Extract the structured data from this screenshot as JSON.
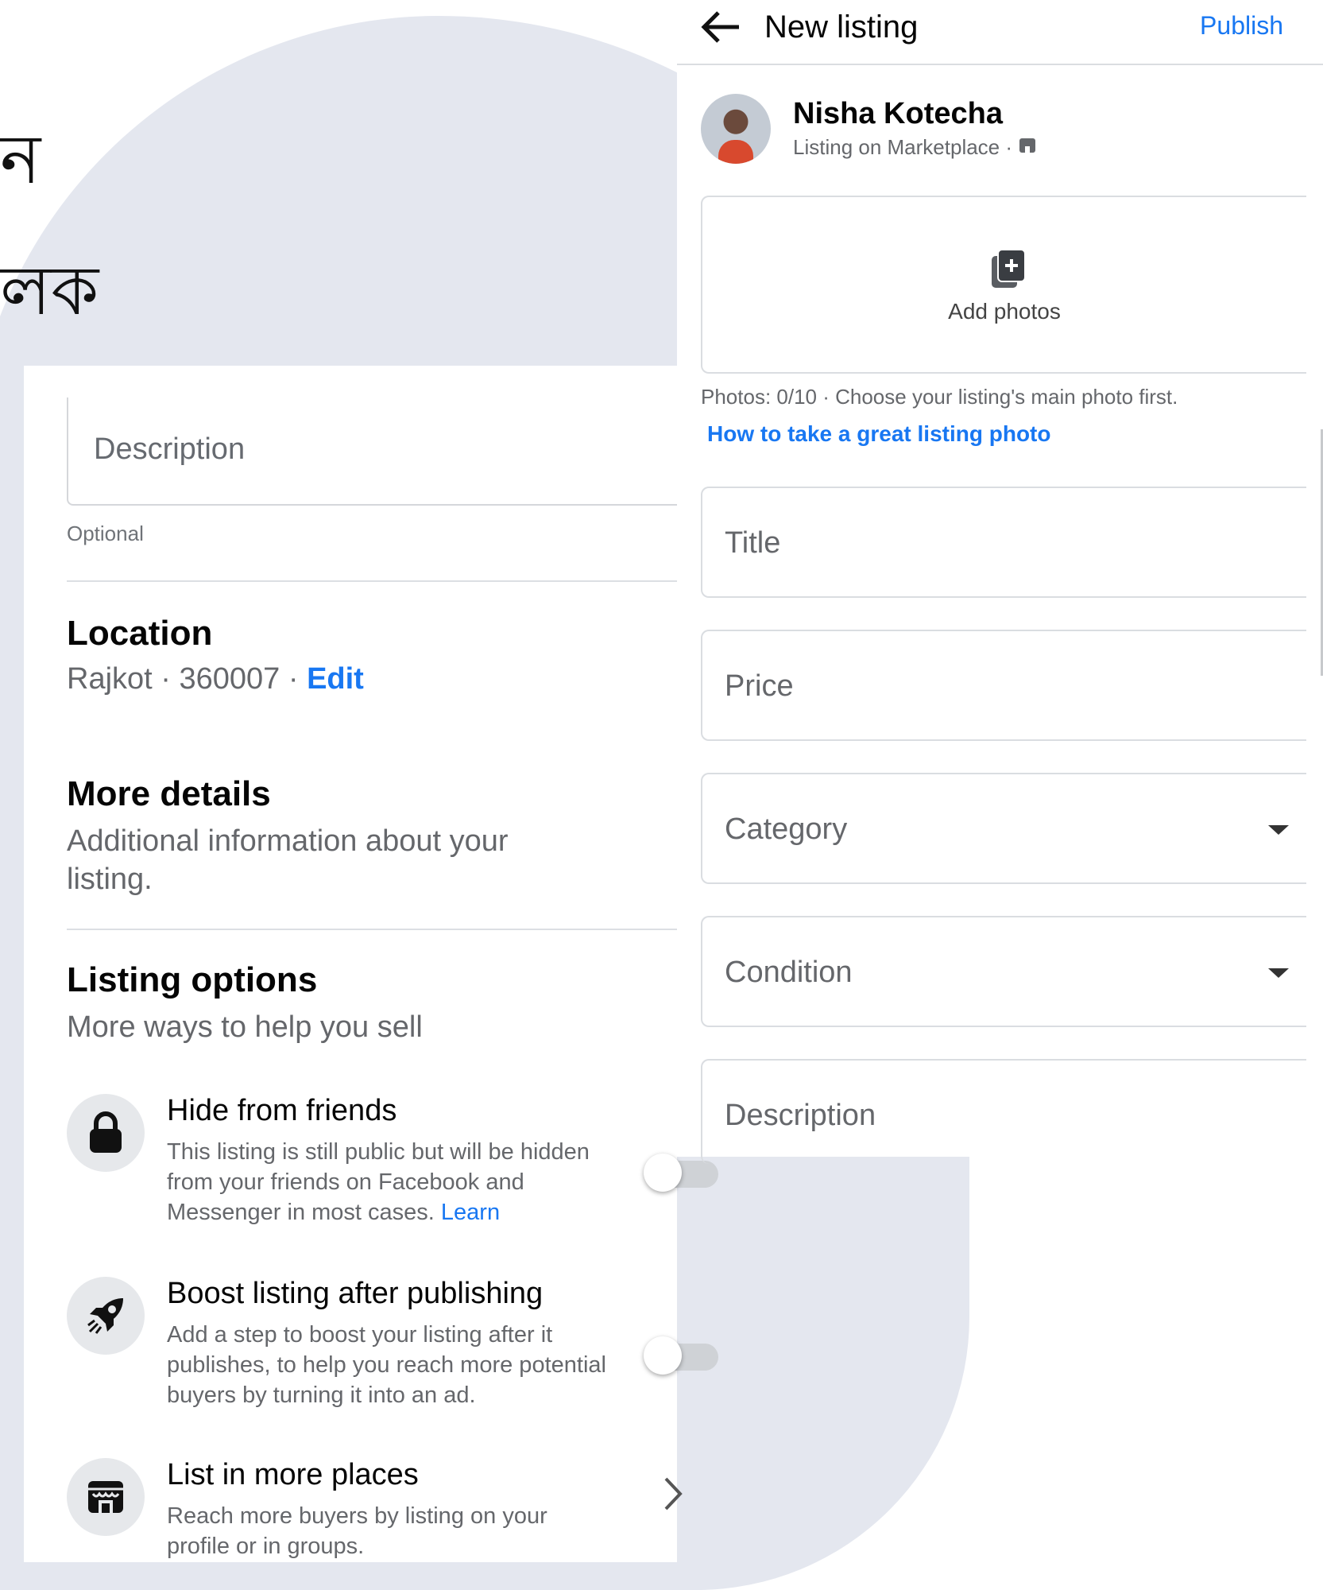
{
  "background_text": [
    "ন",
    "লক"
  ],
  "left_panel": {
    "description_placeholder": "Description",
    "optional_label": "Optional",
    "location": {
      "title": "Location",
      "value": "Rajkot · 360007 · ",
      "edit_label": "Edit"
    },
    "more_details": {
      "title": "More details",
      "subtitle": "Additional information about your listing."
    },
    "listing_options": {
      "title": "Listing options",
      "subtitle": "More ways to help you sell",
      "items": [
        {
          "icon": "lock-icon",
          "title": "Hide from friends",
          "description": "This listing is still public but will be hidden from your friends on Facebook and Messenger in most cases.",
          "link": "Learn",
          "toggle_on": false
        },
        {
          "icon": "rocket-icon",
          "title": "Boost listing after publishing",
          "description": "Add a step to boost your listing after it publishes, to help you reach more potential buyers by turning it into an ad.",
          "toggle_on": false
        },
        {
          "icon": "shop-icon",
          "title": "List in more places",
          "description": "Reach more buyers by listing on your profile or in groups."
        }
      ]
    }
  },
  "right_panel": {
    "header": {
      "title": "New listing",
      "publish_label": "Publish"
    },
    "user": {
      "name": "Nisha Kotecha",
      "subtitle": "Listing on Marketplace · "
    },
    "add_photos_label": "Add photos",
    "photos_info": "Photos: 0/10 · Choose your listing's main photo first.",
    "photo_tip_link": "How to take a great listing photo",
    "fields": {
      "title": "Title",
      "price": "Price",
      "category": "Category",
      "condition": "Condition",
      "description": "Description"
    }
  },
  "colors": {
    "accent": "#1877f2",
    "background_shape": "#e4e7ef",
    "border": "#dadde1",
    "secondary_text": "#65676b"
  }
}
